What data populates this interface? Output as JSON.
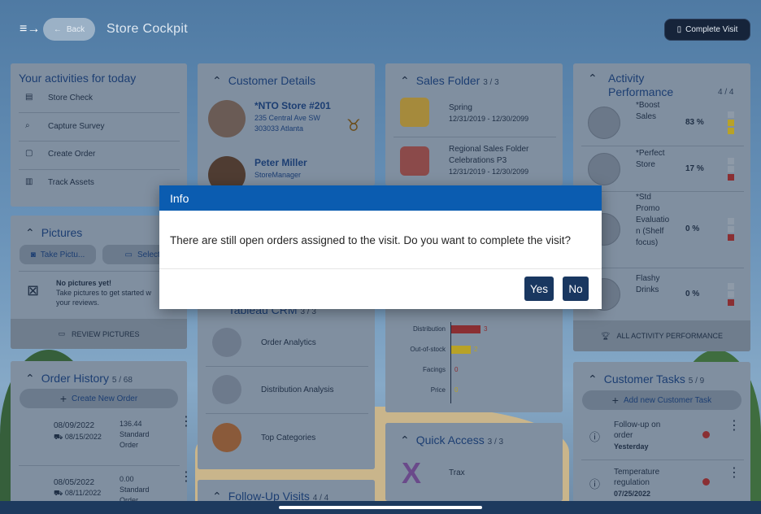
{
  "header": {
    "back_label": "Back",
    "title": "Store Cockpit",
    "complete_visit_label": "Complete Visit"
  },
  "activities": {
    "title": "Your activities for today",
    "items": [
      {
        "label": "Store Check",
        "icon": "clipboard-icon"
      },
      {
        "label": "Capture Survey",
        "icon": "survey-icon"
      },
      {
        "label": "Create Order",
        "icon": "order-icon"
      },
      {
        "label": "Track Assets",
        "icon": "asset-icon"
      }
    ]
  },
  "pictures": {
    "title": "Pictures",
    "take_label": "Take Pictu...",
    "select_label": "Select Pi",
    "empty_title": "No pictures yet!",
    "empty_text_1": "Take pictures to get started w",
    "empty_text_2": "your reviews.",
    "review_label": "REVIEW PICTURES"
  },
  "order_history": {
    "title": "Order History",
    "count": "5 / 68",
    "create_label": "Create New Order",
    "orders": [
      {
        "date": "08/09/2022",
        "delivery": "08/15/2022",
        "amount": "136.44",
        "type1": "Standard",
        "type2": "Order"
      },
      {
        "date": "08/05/2022",
        "delivery": "08/11/2022",
        "amount": "0.00",
        "type1": "Standard",
        "type2": "Order"
      }
    ]
  },
  "customer_details": {
    "title": "Customer Details",
    "store_name": "*NTO Store #201",
    "store_addr1": "235 Central Ave SW",
    "store_addr2": "303033 Atlanta",
    "contact_name": "Peter Miller",
    "contact_role": "StoreManager"
  },
  "tableau": {
    "title": "Tableau CRM",
    "count": "3 / 3",
    "items": [
      {
        "label": "Order Analytics"
      },
      {
        "label": "Distribution Analysis"
      },
      {
        "label": "Top Categories"
      }
    ]
  },
  "followup": {
    "title": "Follow-Up Visits",
    "count": "4 / 4"
  },
  "sales_folder": {
    "title": "Sales Folder",
    "count": "3 / 3",
    "items": [
      {
        "line1": "Spring",
        "line2": "",
        "date": "12/31/2019 - 12/30/2099"
      },
      {
        "line1": "Regional Sales Folder",
        "line2": "Celebrations P3",
        "date": "12/31/2019 - 12/30/2099"
      }
    ]
  },
  "kpi_chart": {
    "rows": [
      {
        "label": "Distribution",
        "value": "3",
        "color": "#8a2f33"
      },
      {
        "label": "Out-of-stock",
        "value": "2",
        "color": "#b8a227"
      },
      {
        "label": "Facings",
        "value": "0",
        "color": "#8a2f33"
      },
      {
        "label": "Price",
        "value": "0",
        "color": "#b8a227"
      }
    ]
  },
  "quick_access": {
    "title": "Quick Access",
    "count": "3 / 3",
    "items": [
      {
        "label": "Trax"
      }
    ]
  },
  "activity_performance": {
    "title_line1": "Activity",
    "title_line2": "Performance",
    "count": "4 / 4",
    "rows": [
      {
        "name": [
          "*Boost",
          "Sales"
        ],
        "pct": "83 %",
        "status_color": "#b8a227"
      },
      {
        "name": [
          "*Perfect",
          "Store"
        ],
        "pct": "17 %",
        "status_color": "#8a2f33"
      },
      {
        "name": [
          "*Std",
          "Promo",
          "Evaluatio",
          "n (Shelf",
          "focus)"
        ],
        "pct": "0 %",
        "status_color": "#8a2f33"
      },
      {
        "name": [
          "Flashy",
          "Drinks"
        ],
        "pct": "0 %",
        "status_color": "#8a2f33"
      }
    ],
    "footer_label": "ALL ACTIVITY PERFORMANCE"
  },
  "customer_tasks": {
    "title": "Customer Tasks",
    "count": "5 / 9",
    "add_label": "Add new Customer Task",
    "tasks": [
      {
        "line1": "Follow-up on",
        "line2": "order",
        "due": "Yesterday"
      },
      {
        "line1": "Temperature",
        "line2": "regulation",
        "due": "07/25/2022"
      }
    ]
  },
  "dialog": {
    "title": "Info",
    "message": "There are still open orders assigned to the visit. Do you want to complete the visit?",
    "yes_label": "Yes",
    "no_label": "No"
  }
}
